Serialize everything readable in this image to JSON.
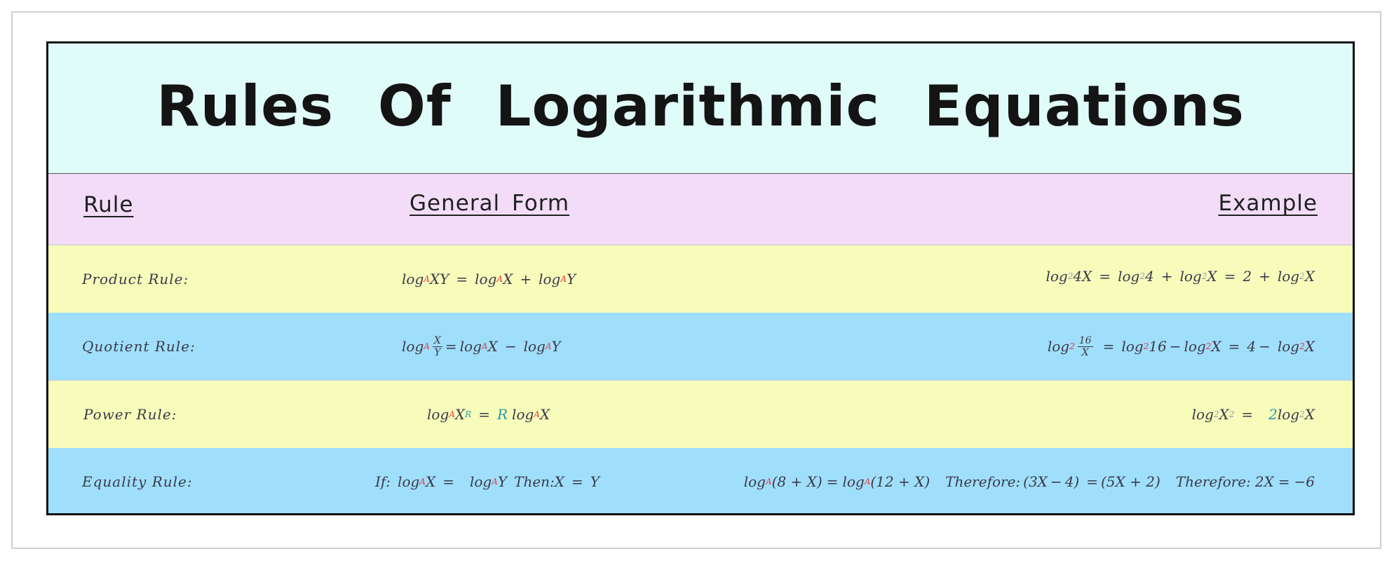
{
  "title": "Rules Of Logarithmic Equations",
  "headers": {
    "rule": "Rule",
    "general": "General Form",
    "example": "Example"
  },
  "rows": [
    {
      "rule": "Product Rule:"
    },
    {
      "rule": "Quotient Rule:"
    },
    {
      "rule": "Power Rule:"
    },
    {
      "rule": "Equality Rule:"
    }
  ],
  "colors": {
    "title_band": "#e0fcf8",
    "header_band": "#f2dcf7",
    "yellow_row": "#f7fcbb",
    "blue_row": "#a0dffb",
    "base_subscript": "#ee3b3b",
    "exponent_accent": "#2a9aaa"
  }
}
